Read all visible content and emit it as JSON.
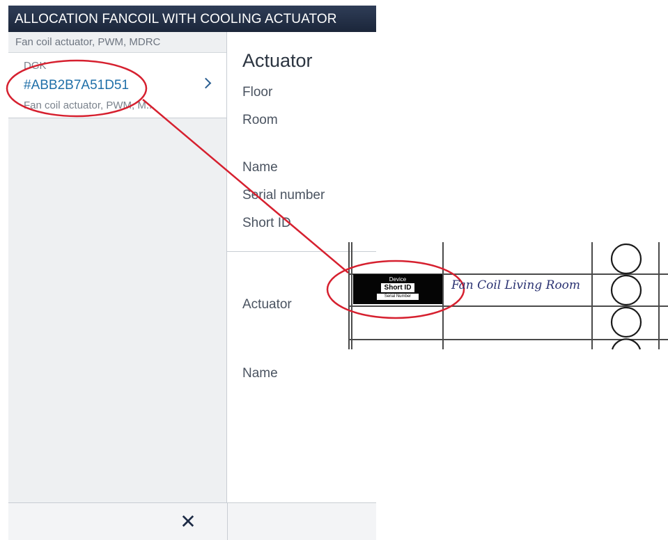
{
  "window": {
    "title": "ALLOCATION FANCOIL WITH COOLING ACTUATOR"
  },
  "device_list": {
    "header": "Fan coil actuator, PWM, MDRC",
    "items": [
      {
        "kind": "DGK",
        "id": "#ABB2B7A51D51",
        "description": "Fan coil actuator, PWM, M..."
      }
    ]
  },
  "details": {
    "title": "Actuator",
    "fields": {
      "floor": "Floor",
      "room": "Room",
      "name": "Name",
      "serial_number": "Serial number",
      "short_id": "Short ID"
    },
    "section2": {
      "actuator_label": "Actuator",
      "name_label": "Name"
    }
  },
  "footer": {
    "close_icon": "close-icon"
  },
  "label_photo": {
    "sticker": {
      "device": "Device",
      "short_id": "Short ID",
      "serial": "Serial Number"
    },
    "handwriting": "Fan Coil Living Room"
  },
  "colors": {
    "titlebar": "#1b263a",
    "link": "#1f6fa8",
    "annotation": "#d6202f"
  }
}
